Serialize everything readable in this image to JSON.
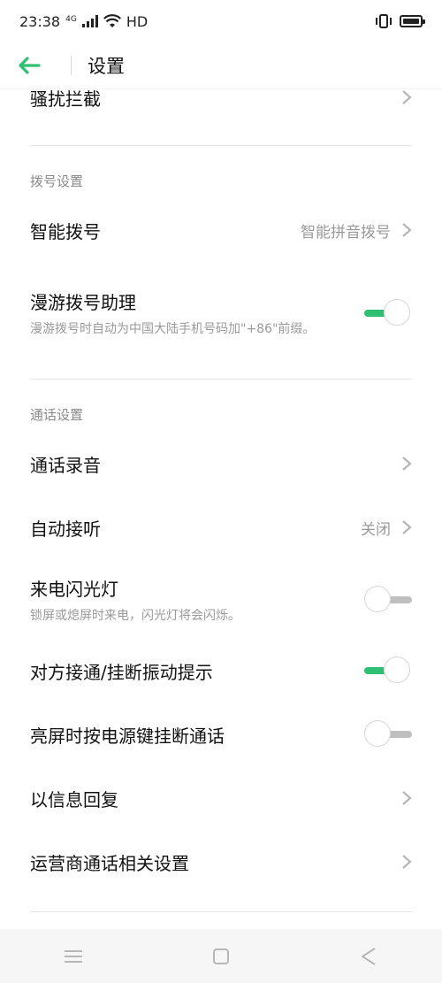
{
  "status_bar": {
    "time": "23:38",
    "network": "HD",
    "net_type": "4G"
  },
  "header": {
    "title": "设置"
  },
  "colors": {
    "accent": "#2fbf71",
    "text": "#111111",
    "secondary": "#9a9a9a",
    "divider": "#e6e6e6"
  },
  "rows": {
    "harassment": {
      "label": "骚扰拦截"
    },
    "dial_section": "拨号设置",
    "smart_dial": {
      "label": "智能拨号",
      "value": "智能拼音拨号"
    },
    "roaming": {
      "label": "漫游拨号助理",
      "desc": "漫游拨号时自动为中国大陆手机号码加\"+86\"前缀。",
      "enabled": true
    },
    "call_section": "通话设置",
    "call_recording": {
      "label": "通话录音"
    },
    "auto_answer": {
      "label": "自动接听",
      "value": "关闭"
    },
    "flash": {
      "label": "来电闪光灯",
      "desc": "锁屏或熄屏时来电，闪光灯将会闪烁。",
      "enabled": false
    },
    "vibrate": {
      "label": "对方接通/挂断振动提示",
      "enabled": true
    },
    "power_hangup": {
      "label": "亮屏时按电源键挂断通话",
      "enabled": false
    },
    "sms_reply": {
      "label": "以信息回复"
    },
    "carrier": {
      "label": "运营商通话相关设置"
    }
  },
  "icons": {
    "back": "back-arrow-icon",
    "chevron": "chevron-right-icon",
    "menu": "menu-icon",
    "home": "home-icon",
    "recent": "back-triangle-icon"
  }
}
